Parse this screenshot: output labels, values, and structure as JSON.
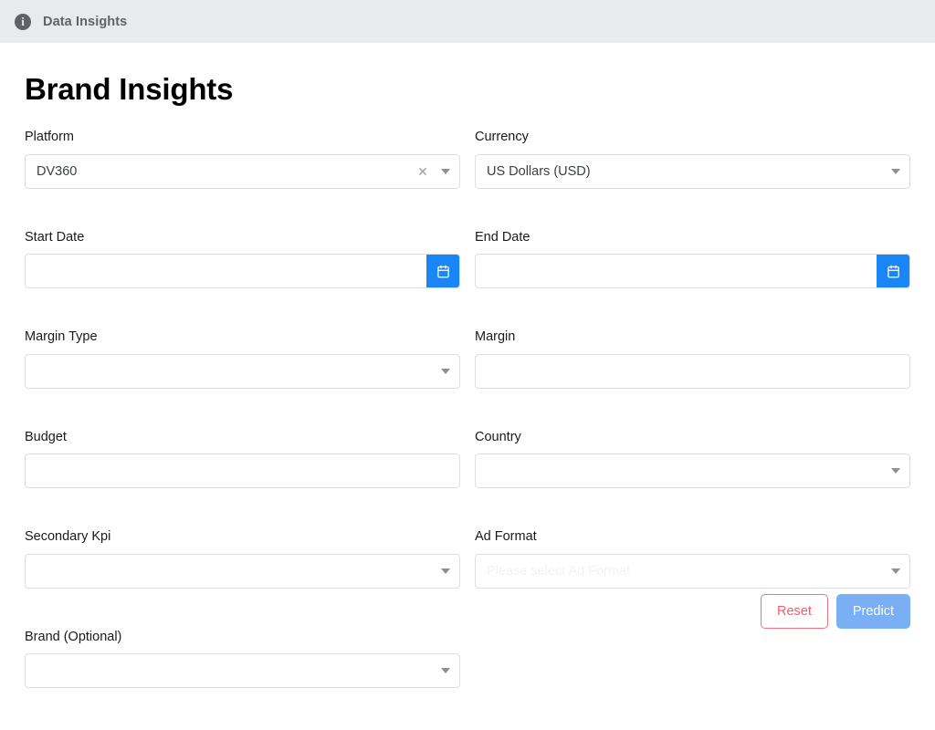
{
  "appbar": {
    "icon": "info-icon",
    "title": "Data Insights"
  },
  "page": {
    "title": "Brand Insights"
  },
  "form": {
    "rows": [
      {
        "left": {
          "label": "Platform",
          "value": "DV360",
          "type": "select-clearable"
        },
        "right": {
          "label": "Currency",
          "value": "US Dollars (USD)",
          "type": "select"
        }
      },
      {
        "left": {
          "label": "Start Date",
          "value": "",
          "type": "date"
        },
        "right": {
          "label": "End Date",
          "value": "",
          "type": "date"
        }
      },
      {
        "left": {
          "label": "Margin Type",
          "value": "",
          "type": "select"
        },
        "right": {
          "label": "Margin",
          "value": "",
          "type": "text"
        }
      },
      {
        "left": {
          "label": "Budget",
          "value": "",
          "type": "text"
        },
        "right": {
          "label": "Country",
          "value": "",
          "type": "select"
        }
      },
      {
        "left": {
          "label": "Secondary Kpi",
          "value": "",
          "type": "select"
        },
        "right": {
          "label": "Ad Format",
          "value": "Please select Ad Format",
          "type": "select-faded"
        }
      },
      {
        "left": {
          "label": "Brand (Optional)",
          "value": "",
          "type": "select"
        },
        "right": null
      }
    ]
  },
  "actions": {
    "reset_label": "Reset",
    "predict_label": "Predict"
  },
  "colors": {
    "appbar_bg": "#e8eaed",
    "accent_blue": "#1a85f5",
    "predict_blue": "#7aaef5",
    "reset_red": "#ef5f6b",
    "border": "#dcdfe3",
    "edge_tab": "#1a85f5"
  }
}
